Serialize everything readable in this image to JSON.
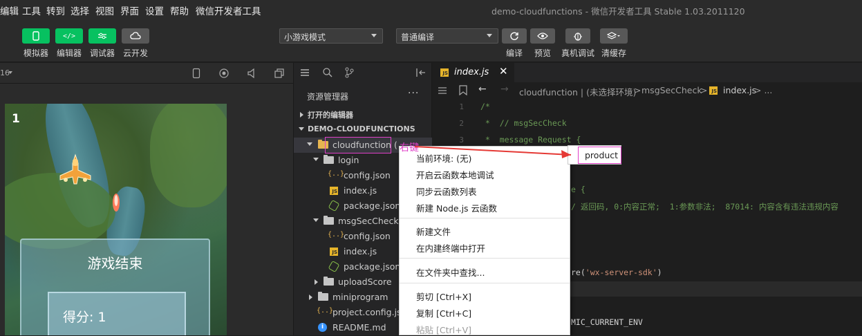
{
  "menubar": {
    "items": [
      "编辑",
      "工具",
      "转到",
      "选择",
      "视图",
      "界面",
      "设置",
      "帮助",
      "微信开发者工具"
    ],
    "window_title": "demo-cloudfunctions - 微信开发者工具 Stable 1.03.2011120"
  },
  "toolbar": {
    "left_buttons": [
      "模拟器",
      "编辑器",
      "调试器",
      "云开发"
    ],
    "mode_select": "小游戏模式",
    "compile_select": "普通编译",
    "right_buttons": [
      "编译",
      "预览",
      "真机调试",
      "清缓存"
    ]
  },
  "simulator": {
    "zoom_label": "16",
    "score": "1",
    "game_over_title": "游戏结束",
    "score_label": "得分: 1"
  },
  "explorer": {
    "title": "资源管理器",
    "more": "···",
    "open_editors": "打开的编辑器",
    "project": "DEMO-CLOUDFUNCTIONS",
    "cloudfunction_label": "cloudfunction",
    "cloudfunction_suffix": "(",
    "tree": {
      "login": "login",
      "login_config": "config.json",
      "login_index": "index.js",
      "login_package": "package.json",
      "msgSecCheck": "msgSecCheck",
      "msg_config": "config.json",
      "msg_index": "index.js",
      "msg_package": "package.json",
      "uploadScore": "uploadScore",
      "miniprogram": "miniprogram",
      "project_config": "project.config.json",
      "readme": "README.md"
    }
  },
  "editor": {
    "tab_label": "index.js",
    "breadcrumb": {
      "part1": "cloudfunction | (未选择环境)",
      "sep1": ">",
      "part2": "msgSecCheck",
      "sep2": ">",
      "part3": "index.js",
      "sep3": "> ..."
    },
    "line_numbers": [
      "1",
      "2",
      "3"
    ],
    "code": {
      "l1": "/*",
      "l2": " *  // msgSecCheck",
      "l3": " *  message Request {",
      "l4": "e {",
      "l5": "/ 返回码, 0:内容正常;  1:参数非法;  87014: 内容含有违法违规内容",
      "l6_pre": "re(",
      "l6_str": "'wx-server-sdk'",
      "l6_post": ")",
      "l7": "MIC_CURRENT_ENV"
    }
  },
  "context_menu": {
    "annotation": "右键",
    "items": {
      "current_env": "当前环境: (无)",
      "local_debug": "开启云函数本地调试",
      "sync_list": "同步云函数列表",
      "new_node": "新建 Node.js 云函数",
      "new_file": "新建文件",
      "open_terminal": "在内建终端中打开",
      "find_in_folder": "在文件夹中查找...",
      "cut": "剪切  [Ctrl+X]",
      "copy": "复制  [Ctrl+C]",
      "paste": "粘贴  [Ctrl+V]"
    },
    "submenu_item": "product"
  },
  "colors": {
    "accent_green": "#07c160",
    "highlight_pink": "#e040c8",
    "annotation_red": "#e53935"
  }
}
